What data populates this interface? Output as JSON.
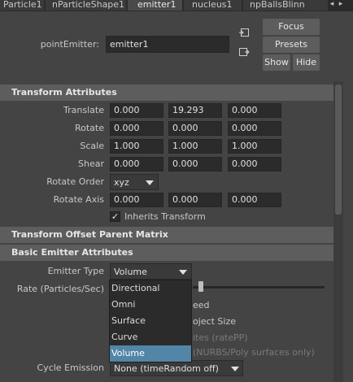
{
  "tabs": [
    {
      "label": "Particle1"
    },
    {
      "label": "nParticleShape1"
    },
    {
      "label": "emitter1"
    },
    {
      "label": "nucleus1"
    },
    {
      "label": "npBallsBlinn"
    }
  ],
  "tab_nav": {
    "left": "◂",
    "right": "▸"
  },
  "node": {
    "label": "pointEmitter:",
    "value": "emitter1"
  },
  "buttons": {
    "focus": "Focus",
    "presets": "Presets",
    "show": "Show",
    "hide": "Hide"
  },
  "transform": {
    "title": "Transform Attributes",
    "translate": {
      "label": "Translate",
      "x": "0.000",
      "y": "19.293",
      "z": "0.000"
    },
    "rotate": {
      "label": "Rotate",
      "x": "0.000",
      "y": "0.000",
      "z": "0.000"
    },
    "scale": {
      "label": "Scale",
      "x": "1.000",
      "y": "1.000",
      "z": "1.000"
    },
    "shear": {
      "label": "Shear",
      "x": "0.000",
      "y": "0.000",
      "z": "0.000"
    },
    "rotate_order": {
      "label": "Rotate Order",
      "value": "xyz"
    },
    "rotate_axis": {
      "label": "Rotate Axis",
      "x": "0.000",
      "y": "0.000",
      "z": "0.000"
    },
    "inherits": {
      "label": "Inherits Transform",
      "checked": true,
      "checkmark": "✓"
    }
  },
  "offset_section": {
    "title": "Transform Offset Parent Matrix"
  },
  "basic": {
    "title": "Basic Emitter Attributes",
    "emitter_type": {
      "label": "Emitter Type",
      "value": "Volume"
    },
    "rate": {
      "label": "Rate (Particles/Sec)",
      "slider_fraction": 0.08
    },
    "partial_1": "eed",
    "partial_2": "oject Size",
    "partial_3": "ites (ratePP)",
    "partial_4": "(NURBS/Poly surfaces only)",
    "cycle": {
      "label": "Cycle Emission",
      "value": "None (timeRandom off)"
    }
  },
  "emitter_menu": {
    "items": [
      "Directional",
      "Omni",
      "Surface",
      "Curve",
      "Volume"
    ],
    "selected": "Volume"
  }
}
